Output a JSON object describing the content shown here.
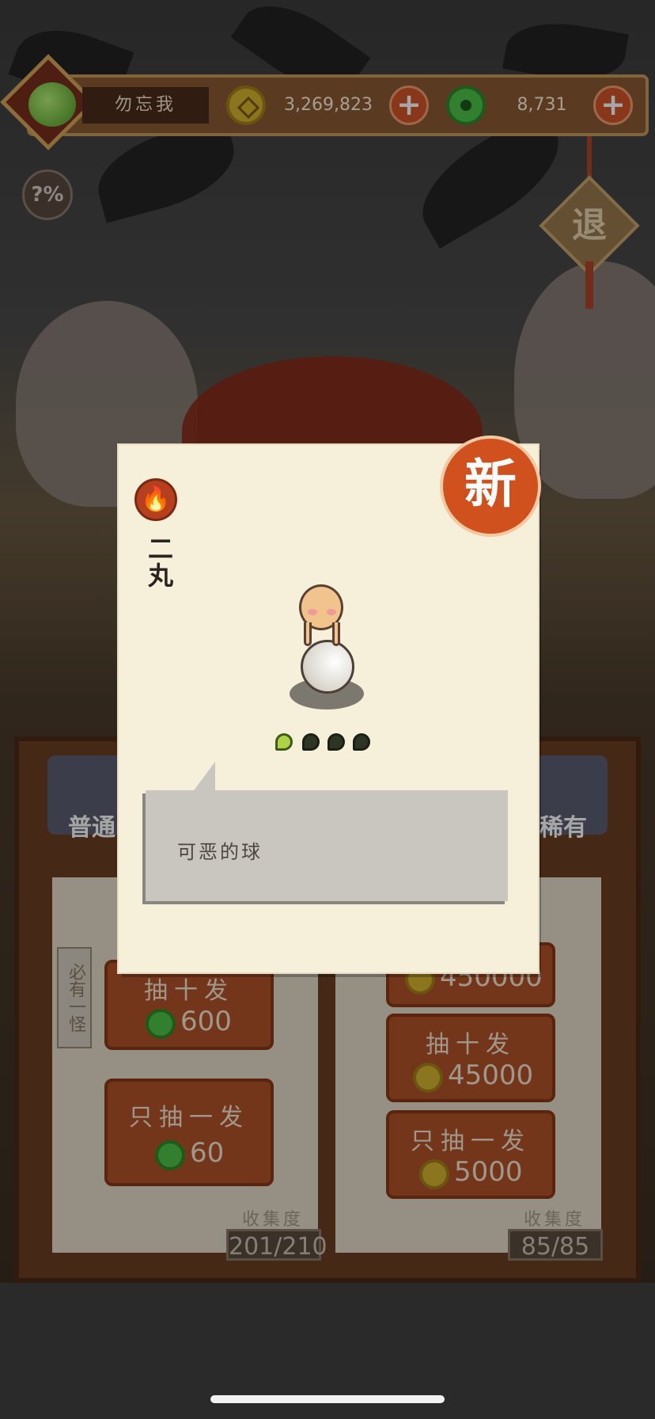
{
  "hud": {
    "player_name": "勿忘我",
    "gold_amount": "3,269,823",
    "jade_amount": "8,731",
    "gold_icon": "gold-coin-icon",
    "jade_icon": "jade-coin-icon",
    "add_label": "+"
  },
  "odds_button": {
    "label": "?%"
  },
  "exit_button": {
    "label": "退"
  },
  "machine": {
    "left_tab": "普通",
    "right_tab": "稀有",
    "side_tag": "必有一怪",
    "left_buttons": [
      {
        "label": "抽十发",
        "cost": "600",
        "currency": "jade"
      },
      {
        "label": "只抽一发",
        "cost": "60",
        "currency": "jade"
      }
    ],
    "right_buttons": [
      {
        "label": "",
        "cost": "450000",
        "currency": "gold"
      },
      {
        "label": "抽十发",
        "cost": "45000",
        "currency": "gold"
      },
      {
        "label": "只抽一发",
        "cost": "5000",
        "currency": "gold"
      }
    ],
    "collect_label": "收集度",
    "left_collection": "201/210",
    "right_collection": "85/85"
  },
  "card": {
    "new_badge": "新",
    "element_icon": "fire-icon",
    "monster_name": "二丸",
    "rarity_stars": {
      "lit": 1,
      "total": 4
    },
    "description": "可恶的球"
  },
  "colors": {
    "accent": "#d0501e",
    "card_bg": "#f6efda",
    "panel": "#6b3e22"
  }
}
